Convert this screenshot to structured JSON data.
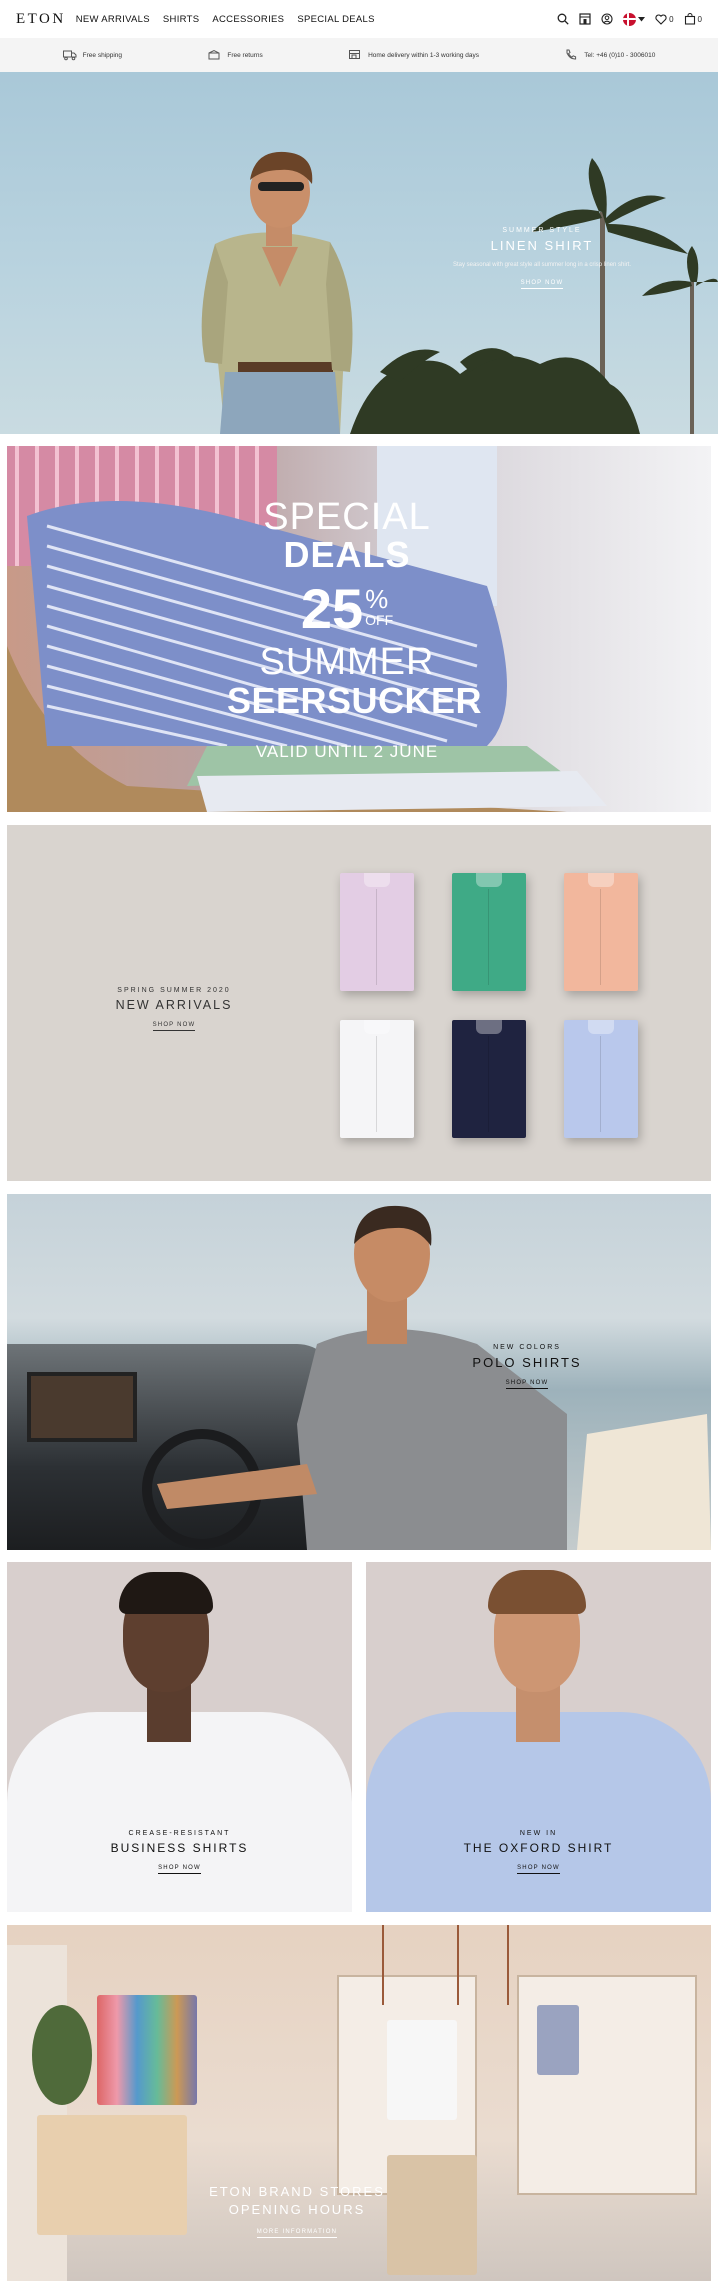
{
  "header": {
    "logo": "ETON",
    "nav": [
      "NEW ARRIVALS",
      "SHIRTS",
      "ACCESSORIES",
      "SPECIAL DEALS"
    ],
    "wishlist_count": "0",
    "cart_count": "0",
    "icons": [
      "search-icon",
      "store-icon",
      "account-icon",
      "flag-denmark-icon",
      "chevron-down-icon",
      "heart-icon",
      "bag-icon"
    ]
  },
  "usp": [
    {
      "icon": "truck-icon",
      "text": "Free shipping"
    },
    {
      "icon": "return-box-icon",
      "text": "Free returns"
    },
    {
      "icon": "delivery-truck-icon",
      "text": "Home delivery within 1-3 working days"
    },
    {
      "icon": "phone-icon",
      "text": "Tel: +46 (0)10 - 3006010"
    }
  ],
  "hero": {
    "kicker": "SUMMER STYLE",
    "headline": "LINEN SHIRT",
    "subtext": "Stay seasonal with great style all summer long in a crisp linen shirt.",
    "cta": "SHOP NOW"
  },
  "deals": {
    "line1": "SPECIAL",
    "line2": "DEALS",
    "percent_number": "25",
    "percent_sign": "%",
    "off": "OFF",
    "line3": "SUMMER",
    "line4": "SEERSUCKER",
    "validity": "VALID UNTIL 2 JUNE"
  },
  "arrivals": {
    "kicker": "SPRING SUMMER 2020",
    "headline": "NEW ARRIVALS",
    "cta": "SHOP NOW",
    "shirt_colors": [
      "#e3cde4",
      "#3faa86",
      "#f2b79d",
      "#f5f5f7",
      "#1f2340",
      "#b9c8ec"
    ]
  },
  "polo": {
    "kicker": "NEW COLORS",
    "headline": "POLO SHIRTS",
    "cta": "SHOP NOW"
  },
  "business": {
    "kicker": "CREASE-RESISTANT",
    "headline": "BUSINESS SHIRTS",
    "cta": "SHOP NOW"
  },
  "oxford": {
    "kicker": "NEW IN",
    "headline": "THE OXFORD SHIRT",
    "cta": "SHOP NOW"
  },
  "store": {
    "headline_line1": "ETON BRAND STORES",
    "headline_line2": "OPENING HOURS",
    "cta": "MORE INFORMATION"
  }
}
